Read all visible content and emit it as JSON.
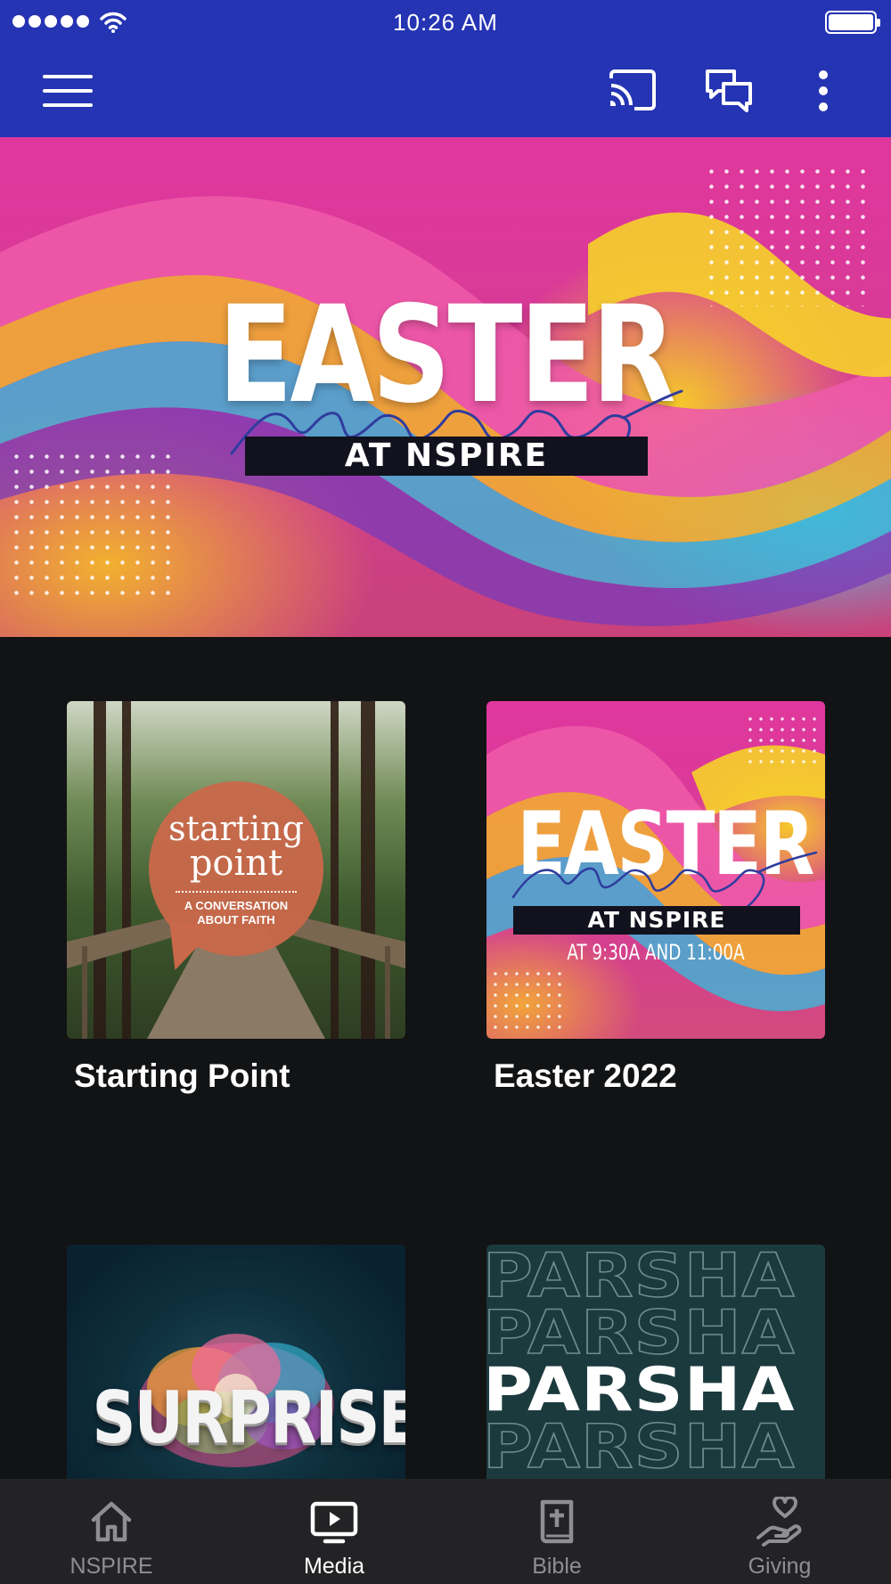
{
  "status_bar": {
    "time": "10:26 AM"
  },
  "hero": {
    "title": "EASTER",
    "script": "sunday",
    "band": "AT NSPIRE"
  },
  "media": [
    {
      "title": "Starting Point",
      "art": {
        "line1": "starting",
        "line2": "point",
        "subtitle_1": "A CONVERSATION",
        "subtitle_2": "ABOUT FAITH"
      }
    },
    {
      "title": "Easter 2022",
      "art": {
        "title": "EASTER",
        "band": "AT NSPIRE",
        "times": "AT 9:30A AND 11:00A"
      }
    },
    {
      "title": "",
      "art": {
        "title": "SURPRISE"
      }
    },
    {
      "title": "",
      "art": {
        "title": "PARSHA"
      }
    }
  ],
  "bottom_nav": {
    "items": [
      {
        "label": "NSPIRE",
        "icon": "home-icon"
      },
      {
        "label": "Media",
        "icon": "tv-play-icon",
        "active": true
      },
      {
        "label": "Bible",
        "icon": "bible-icon"
      },
      {
        "label": "Giving",
        "icon": "giving-hand-heart-icon"
      }
    ]
  },
  "colors": {
    "app_bar": "#2534b3",
    "background": "#121315",
    "bottom_nav": "#232325",
    "nav_inactive": "#8e8e93",
    "nav_active": "#ffffff"
  }
}
